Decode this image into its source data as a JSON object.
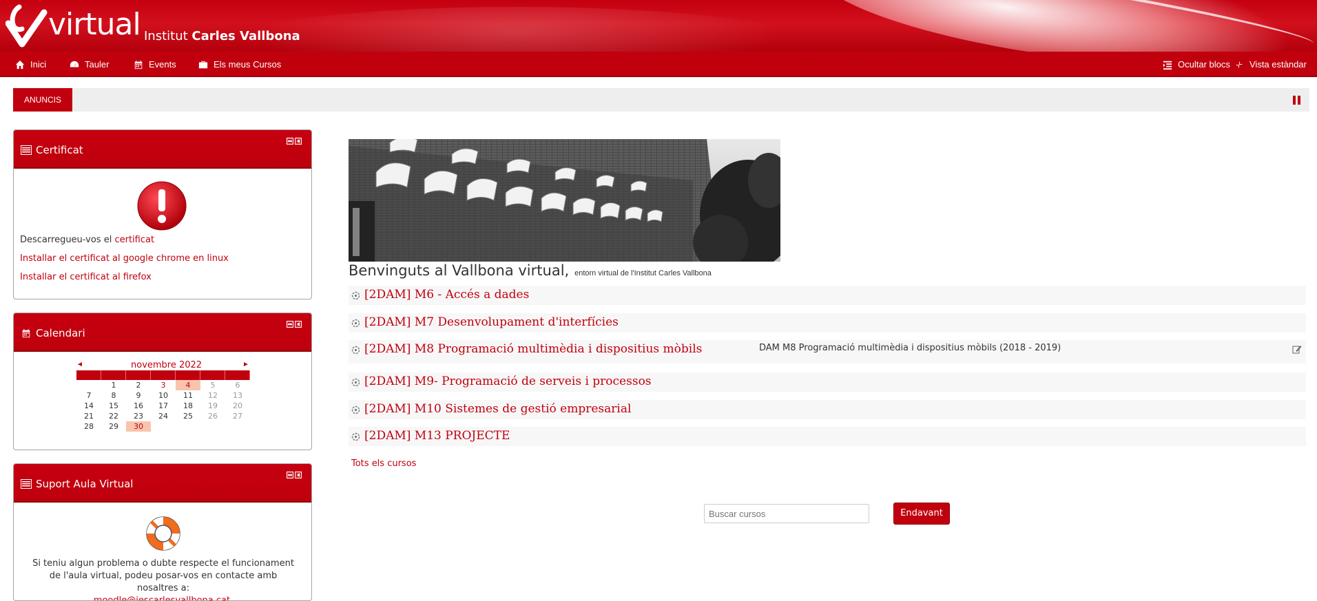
{
  "header": {
    "logo_text": "virtual",
    "institute_prefix": "Institut",
    "institute_name": "Carles Vallbona"
  },
  "nav": {
    "items": [
      {
        "label": "Inici",
        "icon": "home-icon"
      },
      {
        "label": "Tauler",
        "icon": "dashboard-icon"
      },
      {
        "label": "Events",
        "icon": "calendar-icon"
      },
      {
        "label": "Els meus Cursos",
        "icon": "briefcase-icon"
      }
    ],
    "hide_blocks": "Ocultar blocs",
    "standard_view": "Vista estàndar"
  },
  "news": {
    "label": "ANUNCIS"
  },
  "blocks": {
    "certificat": {
      "title": "Certificat",
      "download_prefix": "Descarregueu-vos el",
      "download_link": "certificat",
      "chrome_link": "Installar el certificat al google chrome en linux",
      "firefox_link": "Installar el certificat al firefox"
    },
    "calendar": {
      "title": "Calendari",
      "month": "novembre 2022",
      "prev": "◄",
      "next": "►",
      "weeks": [
        [
          "",
          "1",
          "2",
          "3",
          "4",
          "5",
          "6"
        ],
        [
          "7",
          "8",
          "9",
          "10",
          "11",
          "12",
          "13"
        ],
        [
          "14",
          "15",
          "16",
          "17",
          "18",
          "19",
          "20"
        ],
        [
          "21",
          "22",
          "23",
          "24",
          "25",
          "26",
          "27"
        ],
        [
          "28",
          "29",
          "30",
          "",
          "",
          "",
          ""
        ]
      ],
      "event_days": [
        "3",
        "4",
        "30"
      ],
      "highlight_days": [
        "4",
        "30"
      ]
    },
    "support": {
      "title": "Suport Aula Virtual",
      "text": "Si teniu algun problema o dubte respecte el funcionament de l'aula virtual, podeu posar-vos en contacte amb nosaltres a:",
      "email": "moodle@iescarlesvallbona.cat",
      "email_suffix": "."
    }
  },
  "main": {
    "welcome_big": "Benvinguts al Vallbona virtual,",
    "welcome_small": "entorn virtual de l'Institut Carles Vallbona",
    "courses": [
      {
        "name": "[2DAM] M6 - Accés a dades",
        "summary": ""
      },
      {
        "name": "[2DAM] M7 Desenvolupament d'interfícies",
        "summary": ""
      },
      {
        "name": "[2DAM] M8 Programació multimèdia i dispositius mòbils",
        "summary": "DAM M8 Programació multimèdia i dispositius mòbils (2018 - 2019)"
      },
      {
        "name": "[2DAM] M9- Programació de serveis i processos",
        "summary": ""
      },
      {
        "name": "[2DAM] M10 Sistemes de gestió empresarial",
        "summary": ""
      },
      {
        "name": "[2DAM] M13 PROJECTE",
        "summary": ""
      }
    ],
    "all_courses": "Tots els cursos",
    "search_placeholder": "Buscar cursos",
    "search_button": "Endavant"
  },
  "colors": {
    "brand_red": "#c1000e",
    "highlight": "#f9c4ad"
  }
}
